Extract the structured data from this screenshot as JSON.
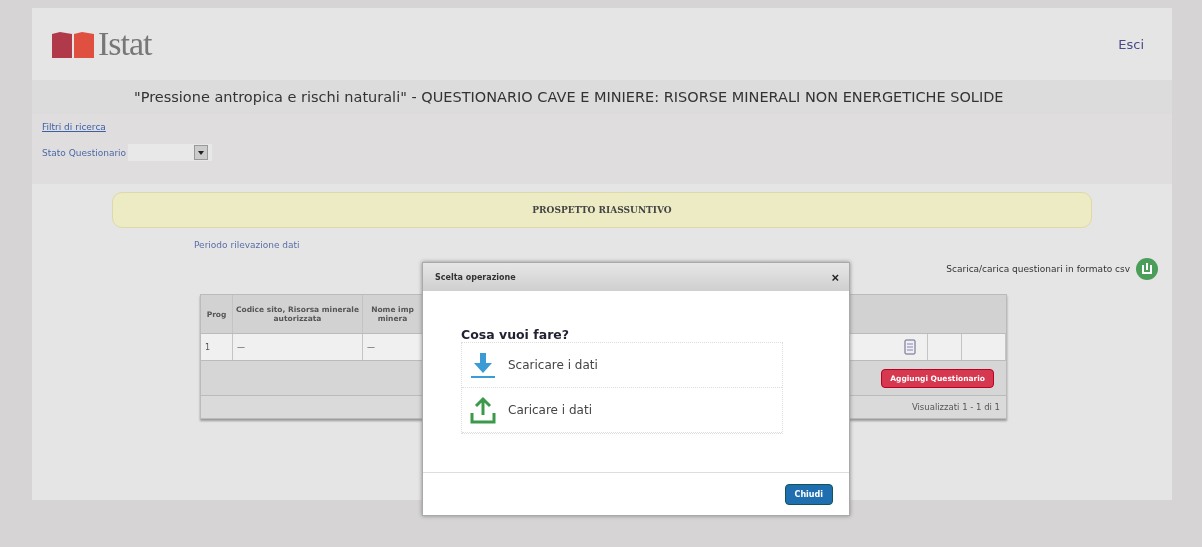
{
  "header": {
    "logo_text": "Istat",
    "exit_link": "Esci"
  },
  "title": "\"Pressione antropica e rischi naturali\" - QUESTIONARIO CAVE E MINIERE: RISORSE MINERALI NON ENERGETICHE SOLIDE",
  "filters": {
    "link": "Filtri di ricerca",
    "status_label": "Stato Questionario"
  },
  "summary_banner": "PROSPETTO RIASSUNTIVO",
  "period_label": "Periodo rilevazione dati",
  "csv_label": "Scarica/carica questionari in formato csv",
  "table": {
    "columns": [
      "Prog",
      "Codice sito, Risorsa minerale autorizzata",
      "Nome imp minera"
    ],
    "rows": [
      {
        "cells": [
          "1",
          "—",
          "—"
        ]
      }
    ],
    "add_button": "Aggiungi Questionario",
    "pager": "Visualizzati 1 - 1 di 1"
  },
  "dialog": {
    "title": "Scelta operazione",
    "close": "×",
    "question": "Cosa vuoi fare?",
    "options": [
      {
        "kind": "download",
        "label": "Scaricare i dati"
      },
      {
        "kind": "upload",
        "label": "Caricare i dati"
      }
    ],
    "button": "Chiudi"
  }
}
